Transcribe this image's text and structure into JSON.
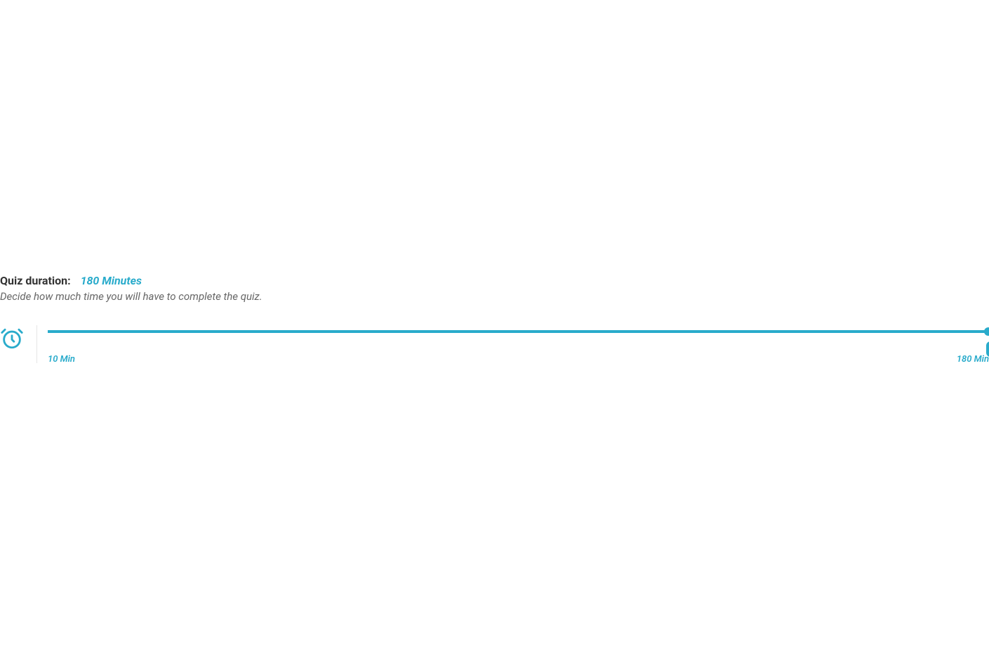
{
  "duration": {
    "label": "Quiz duration:",
    "value": "180 Minutes",
    "description": "Decide how much time you will have to complete the quiz.",
    "slider": {
      "min_label": "10 Min",
      "max_label": "180 Min",
      "min": 10,
      "max": 180,
      "current": 180
    }
  },
  "colors": {
    "accent": "#29abcb"
  }
}
